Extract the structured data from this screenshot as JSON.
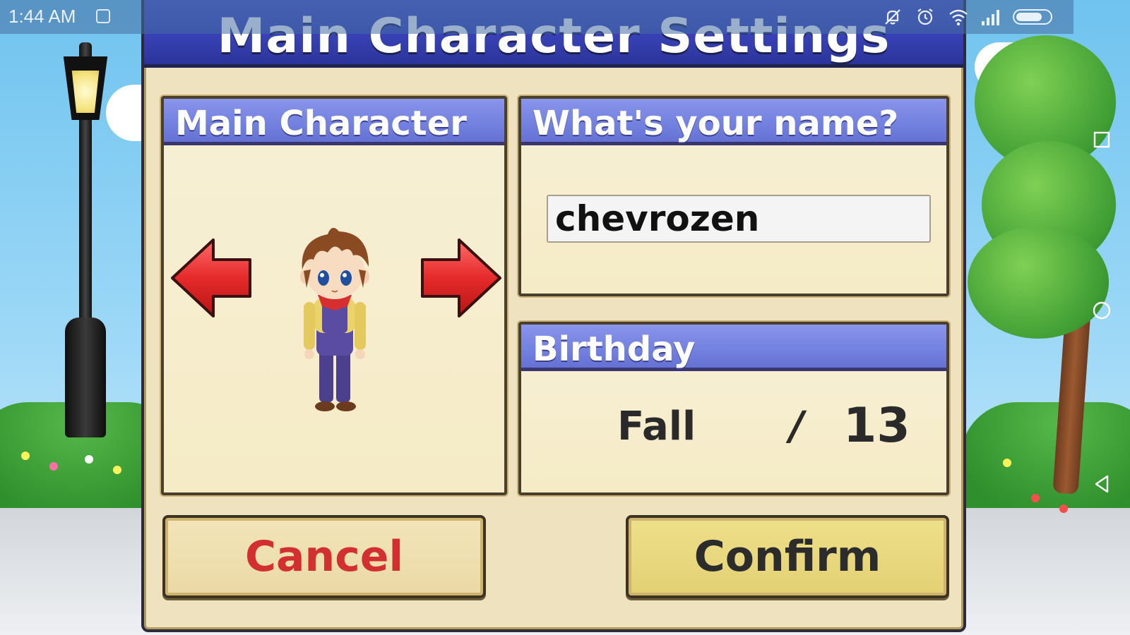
{
  "status_bar": {
    "time": "1:44 AM"
  },
  "dialog": {
    "title": "Main Character Settings",
    "character_panel": {
      "header": "Main Character"
    },
    "name_panel": {
      "header": "What's your name?",
      "name_value": "chevrozen"
    },
    "birthday_panel": {
      "header": "Birthday",
      "season": "Fall",
      "separator": "/",
      "day": "13"
    },
    "buttons": {
      "cancel_label": "Cancel",
      "confirm_label": "Confirm"
    }
  },
  "colors": {
    "title_bar": "#3640b2",
    "panel_header": "#7280df",
    "panel_body": "#f5ebc6",
    "dialog_bg": "#efe3bf",
    "cancel_text": "#d23030",
    "confirm_bg": "#e3d073",
    "arrow_red": "#e52a2a"
  },
  "icons": {
    "status_bar": [
      "notification-icon",
      "mute-icon",
      "alarm-icon",
      "wifi-icon",
      "signal-icon",
      "battery-icon"
    ],
    "nav_bar": [
      "recents-icon",
      "home-icon",
      "back-icon"
    ],
    "selector": [
      "arrow-left-icon",
      "arrow-right-icon"
    ]
  }
}
